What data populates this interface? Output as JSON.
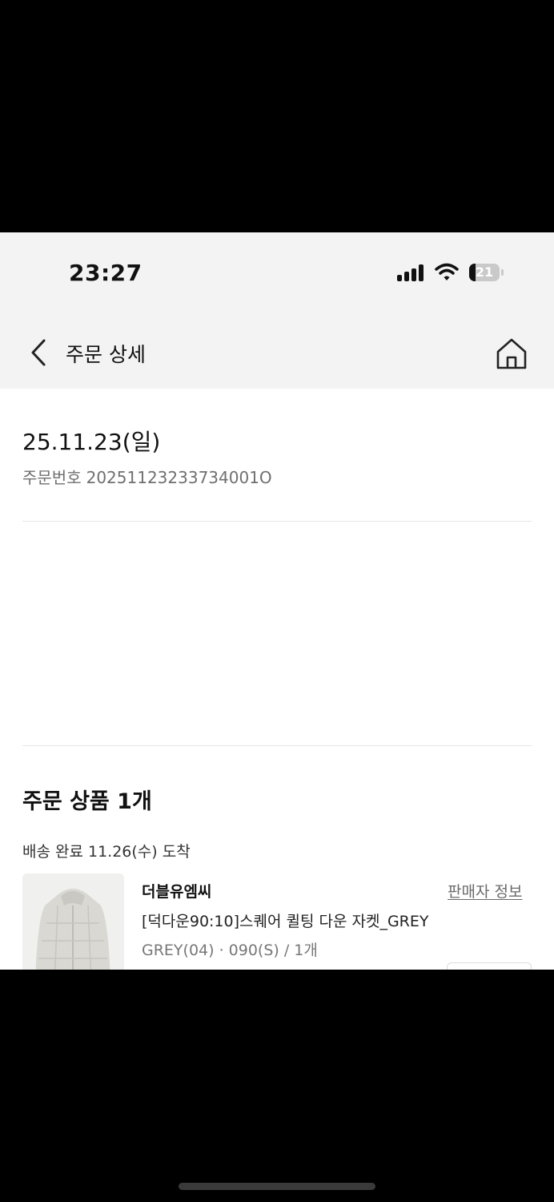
{
  "status_bar": {
    "time": "23:27",
    "battery_percent": "21",
    "battery_level": 0.21
  },
  "nav": {
    "title": "주문 상세",
    "back_icon": "chevron-left-icon",
    "home_icon": "home-icon"
  },
  "order": {
    "date": "25.11.23(일)",
    "number_label": "주문번호",
    "number": "20251123233734001O"
  },
  "products_section": {
    "title": "주문 상품 1개",
    "delivery_status": "배송 완료 11.26(수) 도착",
    "items": [
      {
        "brand": "더블유엠씨",
        "seller_info_label": "판매자 정보",
        "name": "[덕다운90:10]스퀘어 퀼팅 다운 자켓_GREY",
        "option": "GREY(04) · 090(S) / 1개"
      }
    ]
  },
  "colors": {
    "header_bg": "#f3f3f3",
    "text_primary": "#111111",
    "text_secondary": "#6f6f6f",
    "divider": "#e6e6e6"
  }
}
